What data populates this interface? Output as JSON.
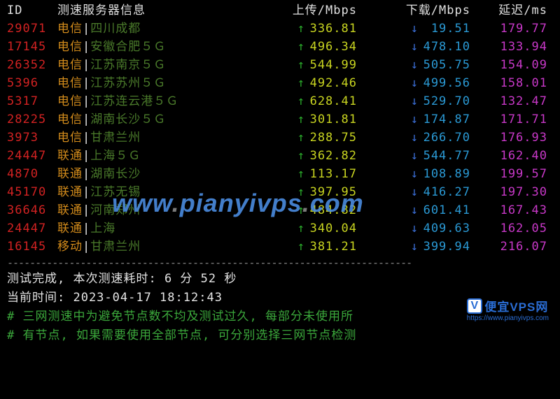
{
  "headers": {
    "id": "ID",
    "server": "测速服务器信息",
    "upload": "上传/Mbps",
    "download": "下载/Mbps",
    "latency": "延迟/ms"
  },
  "rows": [
    {
      "id": "29071",
      "isp": "电信",
      "location": "四川成都",
      "upload": "336.81",
      "download": "19.51",
      "latency": "179.77"
    },
    {
      "id": "17145",
      "isp": "电信",
      "location": "安徽合肥５Ｇ",
      "upload": "496.34",
      "download": "478.10",
      "latency": "133.94"
    },
    {
      "id": "26352",
      "isp": "电信",
      "location": "江苏南京５Ｇ",
      "upload": "544.99",
      "download": "505.75",
      "latency": "154.09"
    },
    {
      "id": "5396",
      "isp": "电信",
      "location": "江苏苏州５Ｇ",
      "upload": "492.46",
      "download": "499.56",
      "latency": "158.01"
    },
    {
      "id": "5317",
      "isp": "电信",
      "location": "江苏连云港５Ｇ",
      "upload": "628.41",
      "download": "529.70",
      "latency": "132.47"
    },
    {
      "id": "28225",
      "isp": "电信",
      "location": "湖南长沙５Ｇ",
      "upload": "301.81",
      "download": "174.87",
      "latency": "171.71"
    },
    {
      "id": "3973",
      "isp": "电信",
      "location": "甘肃兰州",
      "upload": "288.75",
      "download": "266.70",
      "latency": "176.93"
    },
    {
      "id": "24447",
      "isp": "联通",
      "location": "上海５Ｇ",
      "upload": "362.82",
      "download": "544.77",
      "latency": "162.40"
    },
    {
      "id": "4870",
      "isp": "联通",
      "location": "湖南长沙",
      "upload": "113.17",
      "download": "108.89",
      "latency": "199.57"
    },
    {
      "id": "45170",
      "isp": "联通",
      "location": "江苏无锡",
      "upload": "397.95",
      "download": "416.27",
      "latency": "197.30"
    },
    {
      "id": "36646",
      "isp": "联通",
      "location": "河南郑州",
      "upload": "484.82",
      "download": "601.41",
      "latency": "167.43"
    },
    {
      "id": "24447",
      "isp": "联通",
      "location": "上海",
      "upload": "340.04",
      "download": "409.63",
      "latency": "162.05"
    },
    {
      "id": "16145",
      "isp": "移动",
      "location": "甘肃兰州",
      "upload": "381.21",
      "download": "399.94",
      "latency": "216.07"
    }
  ],
  "divider": "------------------------------------------------------------------------",
  "status": {
    "complete": "测试完成, 本次测速耗时: 6 分 52 秒",
    "current_time": "当前时间: 2023-04-17 18:12:43"
  },
  "notes": [
    "# 三网测速中为避免节点数不均及测试过久, 每部分未使用所",
    "# 有节点, 如果需要使用全部节点, 可分别选择三网节点检测"
  ],
  "watermark": {
    "text_prefix": "www",
    "text_mid": "pianyivps",
    "text_suffix": "com"
  },
  "badge": {
    "v": "V",
    "text": "便宜VPS网",
    "url": "https://www.pianyivps.com"
  },
  "symbols": {
    "up": "↑",
    "down": "↓",
    "sep": "|"
  }
}
